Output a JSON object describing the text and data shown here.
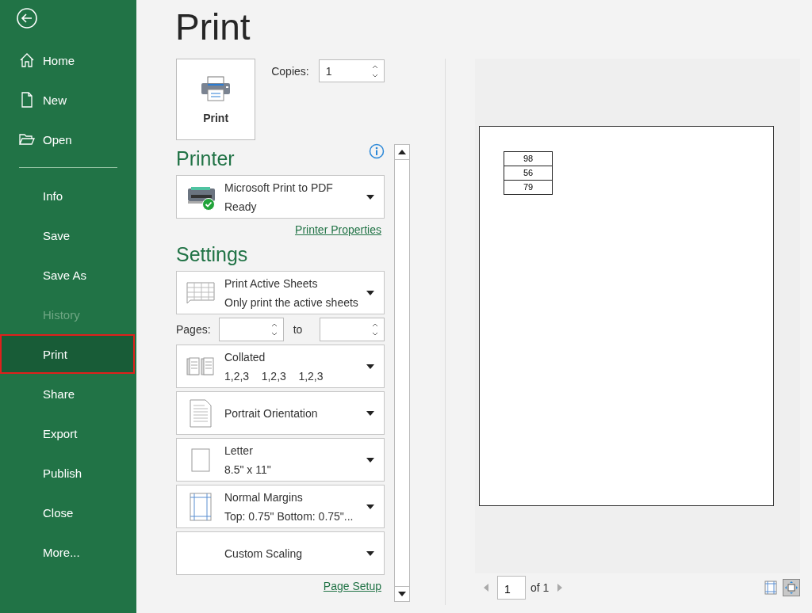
{
  "sidebar": {
    "top_items": [
      {
        "label": "Home"
      },
      {
        "label": "New"
      },
      {
        "label": "Open"
      }
    ],
    "bottom_items": [
      {
        "label": "Info",
        "selected": false,
        "disabled": false
      },
      {
        "label": "Save",
        "selected": false,
        "disabled": false
      },
      {
        "label": "Save As",
        "selected": false,
        "disabled": false
      },
      {
        "label": "History",
        "selected": false,
        "disabled": true
      },
      {
        "label": "Print",
        "selected": true,
        "disabled": false
      },
      {
        "label": "Share",
        "selected": false,
        "disabled": false
      },
      {
        "label": "Export",
        "selected": false,
        "disabled": false
      },
      {
        "label": "Publish",
        "selected": false,
        "disabled": false
      },
      {
        "label": "Close",
        "selected": false,
        "disabled": false
      },
      {
        "label": "More...",
        "selected": false,
        "disabled": false
      }
    ]
  },
  "title": "Print",
  "print_button": "Print",
  "copies": {
    "label": "Copies:",
    "value": "1"
  },
  "printer": {
    "heading": "Printer",
    "name": "Microsoft Print to PDF",
    "status": "Ready",
    "properties_link": "Printer Properties"
  },
  "settings": {
    "heading": "Settings",
    "items": [
      {
        "kind": "sheets",
        "title": "Print Active Sheets",
        "subtitle": "Only print the active sheets"
      },
      {
        "kind": "pages",
        "label": "Pages:",
        "to_label": "to"
      },
      {
        "kind": "collated",
        "title": "Collated",
        "subtitle": "1,2,3    1,2,3    1,2,3"
      },
      {
        "kind": "orientation",
        "title": "Portrait Orientation"
      },
      {
        "kind": "paper",
        "title": "Letter",
        "subtitle": "8.5\" x 11\""
      },
      {
        "kind": "margins",
        "title": "Normal Margins",
        "subtitle": "Top: 0.75\" Bottom: 0.75\"..."
      },
      {
        "kind": "scaling",
        "title": "Custom Scaling"
      }
    ],
    "page_setup_link": "Page Setup"
  },
  "preview": {
    "cells": [
      "98",
      "56",
      "79"
    ],
    "page": "1",
    "page_total": "of 1",
    "view_buttons": [
      {
        "kind": "margins",
        "selected": false
      },
      {
        "kind": "zoom",
        "selected": true
      }
    ]
  }
}
